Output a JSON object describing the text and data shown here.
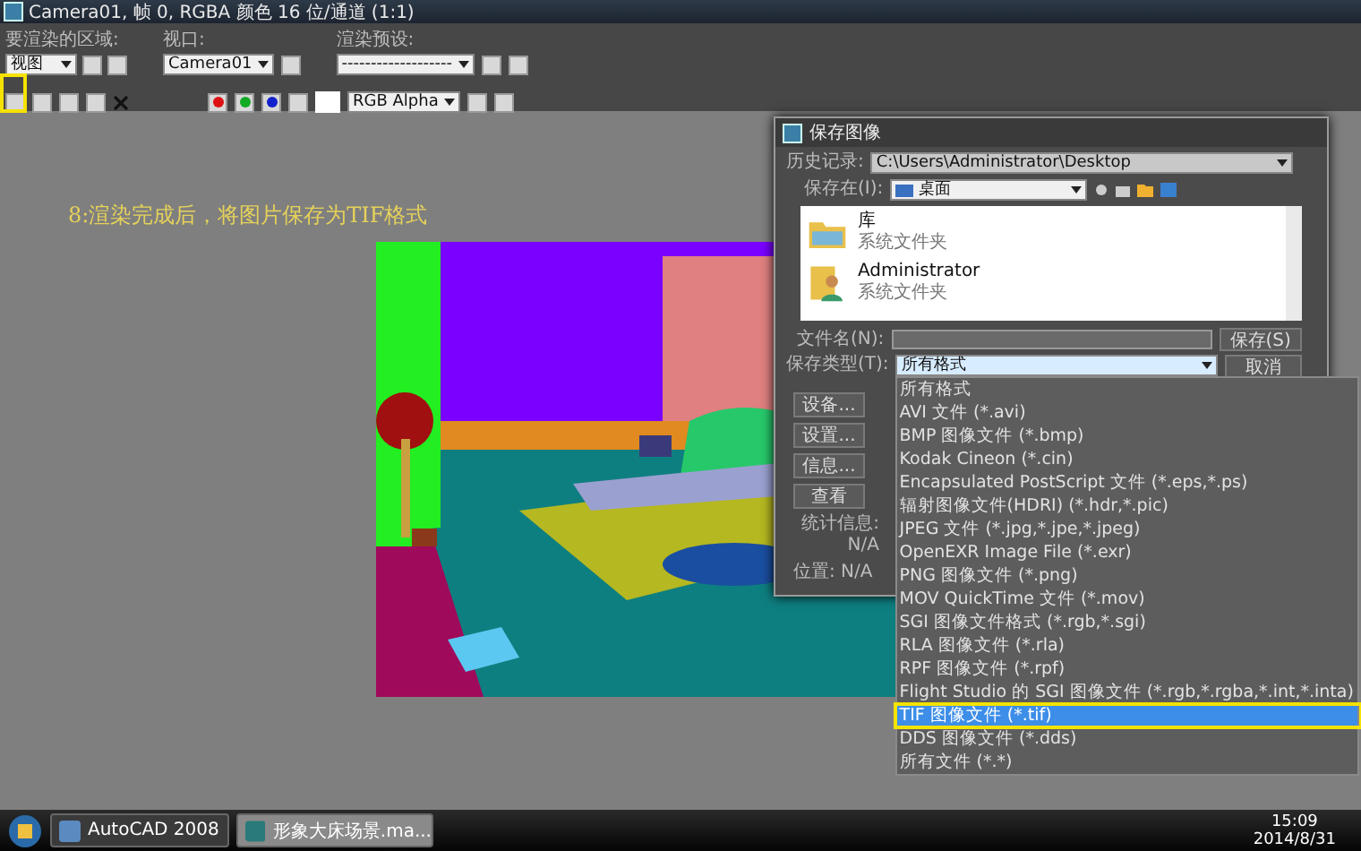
{
  "render_window": {
    "title": "Camera01, 帧 0, RGBA 颜色 16 位/通道 (1:1)",
    "area_label": "要渲染的区域:",
    "area_value": "视图",
    "viewport_label": "视口:",
    "viewport_value": "Camera01",
    "preset_label": "渲染预设:",
    "preset_value": "-------------------",
    "channel_value": "RGB Alpha",
    "channels": [
      {
        "color": "#dd1111"
      },
      {
        "color": "#11aa22"
      },
      {
        "color": "#1122cc"
      }
    ]
  },
  "caption": "8:渲染完成后，将图片保存为TIF格式",
  "save_dialog": {
    "title": "保存图像",
    "history_label": "历史记录:",
    "history_value": "C:\\Users\\Administrator\\Desktop",
    "save_in_label": "保存在(I):",
    "save_in_value": "桌面",
    "files": [
      {
        "kind": "library",
        "name": "库",
        "type": "系统文件夹"
      },
      {
        "kind": "user",
        "name": "Administrator",
        "type": "系统文件夹"
      }
    ],
    "filename_label": "文件名(N):",
    "save_button": "保存(S)",
    "type_label": "保存类型(T):",
    "type_value": "所有格式",
    "cancel_button": "取消",
    "side_buttons": [
      "设备...",
      "设置...",
      "信息...",
      "查看"
    ],
    "stats": "统计信息: N/A",
    "location": "位置: N/A",
    "formats": [
      {
        "label": "所有格式",
        "selected": false
      },
      {
        "label": "AVI 文件 (*.avi)",
        "selected": false
      },
      {
        "label": "BMP 图像文件 (*.bmp)",
        "selected": false
      },
      {
        "label": "Kodak Cineon (*.cin)",
        "selected": false
      },
      {
        "label": "Encapsulated PostScript 文件 (*.eps,*.ps)",
        "selected": false
      },
      {
        "label": "辐射图像文件(HDRI) (*.hdr,*.pic)",
        "selected": false
      },
      {
        "label": "JPEG 文件 (*.jpg,*.jpe,*.jpeg)",
        "selected": false
      },
      {
        "label": "OpenEXR Image File (*.exr)",
        "selected": false
      },
      {
        "label": "PNG 图像文件 (*.png)",
        "selected": false
      },
      {
        "label": "MOV QuickTime 文件 (*.mov)",
        "selected": false
      },
      {
        "label": "SGI 图像文件格式 (*.rgb,*.sgi)",
        "selected": false
      },
      {
        "label": "RLA 图像文件 (*.rla)",
        "selected": false
      },
      {
        "label": "RPF 图像文件 (*.rpf)",
        "selected": false
      },
      {
        "label": "Flight Studio 的 SGI 图像文件 (*.rgb,*.rgba,*.int,*.inta)",
        "selected": false
      },
      {
        "label": "TIF 图像文件 (*.tif)",
        "selected": true
      },
      {
        "label": "DDS 图像文件 (*.dds)",
        "selected": false
      },
      {
        "label": "所有文件 (*.*)",
        "selected": false
      }
    ]
  },
  "taskbar": {
    "items": [
      {
        "label": "AutoCAD 2008",
        "selected": false
      },
      {
        "label": "形象大床场景.ma...",
        "selected": true
      }
    ],
    "time": "15:09",
    "date": "2014/8/31"
  }
}
